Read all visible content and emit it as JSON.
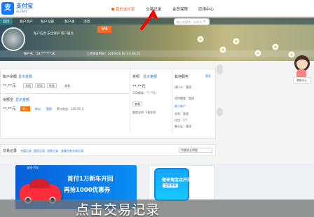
{
  "header": {
    "brand_name": "支付宝",
    "brand_english": "ALIPAY",
    "nav": [
      "我的支付宝",
      "交易记录",
      "会员保障",
      "应用中心"
    ],
    "search_placeholder": "输入关键字、交易号",
    "search_icon": "search-icon"
  },
  "banner": {
    "tabs": [
      "首页",
      "账户资产",
      "账户设置",
      "账户通",
      "消息"
    ],
    "badge": "V4",
    "account_line_left": "账户名：187******26",
    "last_login": "上次登录时间：2019.03.18 13:39:26",
    "hint": "账户信息   安全保护   客户服务"
  },
  "balance": {
    "title": "账户余额",
    "show_amount": "显示金额",
    "amount": "**.**元",
    "actions": [
      "充值",
      "提现",
      "转账",
      "查看"
    ],
    "service_label": "余额宝",
    "service_show": "显示金额",
    "service_amount": "**.**元",
    "service_actions": [
      "转入",
      "转出",
      "管理"
    ],
    "service_income": "累计收益：240.56 元"
  },
  "credit": {
    "title": "花呗",
    "show_amount": "显示金额",
    "credit_line": "**.**元",
    "available": "可用额度：**.**元",
    "details": "查看",
    "lower": "额度说明  下载花呗"
  },
  "services": {
    "title": "其他服务",
    "more": "更多",
    "items": [
      {
        "label": "银行卡：管理",
        "icon": "card-icon"
      },
      {
        "label": "花呗额度：管理",
        "icon": "credit-icon"
      },
      {
        "label": "收入账户",
        "icon": "income-icon"
      },
      {
        "label": "花呗：管理",
        "icon": "credit-icon"
      },
      {
        "label": "红包：1个",
        "icon": "gift-icon"
      },
      {
        "label": "集分宝：管理",
        "icon": "points-icon"
      }
    ]
  },
  "records": {
    "title": "交易记录",
    "filters": [
      "充值记录",
      "提现记录",
      "退款记录",
      "查看所有交易记录"
    ],
    "dropdown": "余额收支明细"
  },
  "ads": {
    "left_tag": "花呗·汽车",
    "left_title": "首付1万新车开回",
    "left_sub": "再抢1000优惠券",
    "right_title": "做来淘宝店开张",
    "right_sub": "立即领取",
    "right_ad_label": "广告"
  },
  "float": {
    "label": "帮助中心"
  },
  "caption": "点击交易记录",
  "colors": {
    "accent": "#ff5a00",
    "blue": "#1677ff",
    "link": "#1e73d8"
  }
}
